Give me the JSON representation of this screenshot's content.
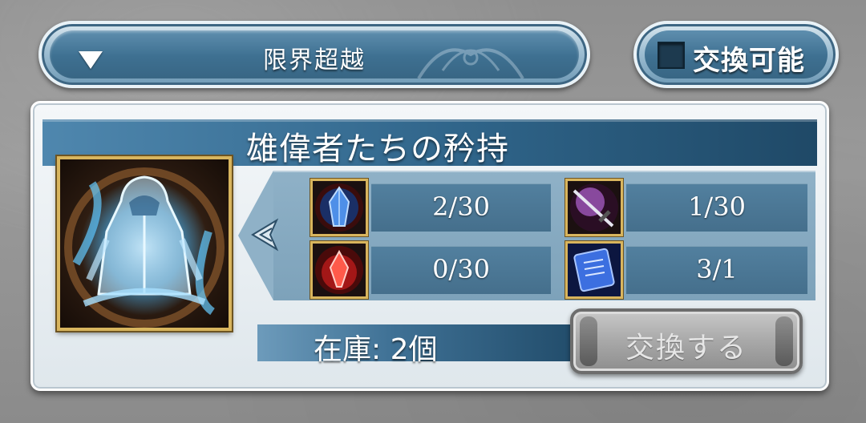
{
  "filter": {
    "selected_label": "限界超越",
    "arrow_icon": "triangle-down-icon"
  },
  "toggle": {
    "label": "交換可能",
    "checked": false
  },
  "card": {
    "title": "雄偉者たちの矜持",
    "item_icon": "hooded-cloak-icon",
    "materials": [
      {
        "icon": "blue-crystal-icon",
        "count": "2/30"
      },
      {
        "icon": "dark-sword-icon",
        "count": "1/30"
      },
      {
        "icon": "red-crystal-icon",
        "count": "0/30"
      },
      {
        "icon": "blue-scroll-icon",
        "count": "3/1"
      }
    ],
    "stock_label": "在庫: 2個",
    "exchange_button": "交換する"
  },
  "colors": {
    "header_blue": "#2f6489",
    "frame_gold": "#d8b55e",
    "button_disabled": "#a8a8a8"
  }
}
